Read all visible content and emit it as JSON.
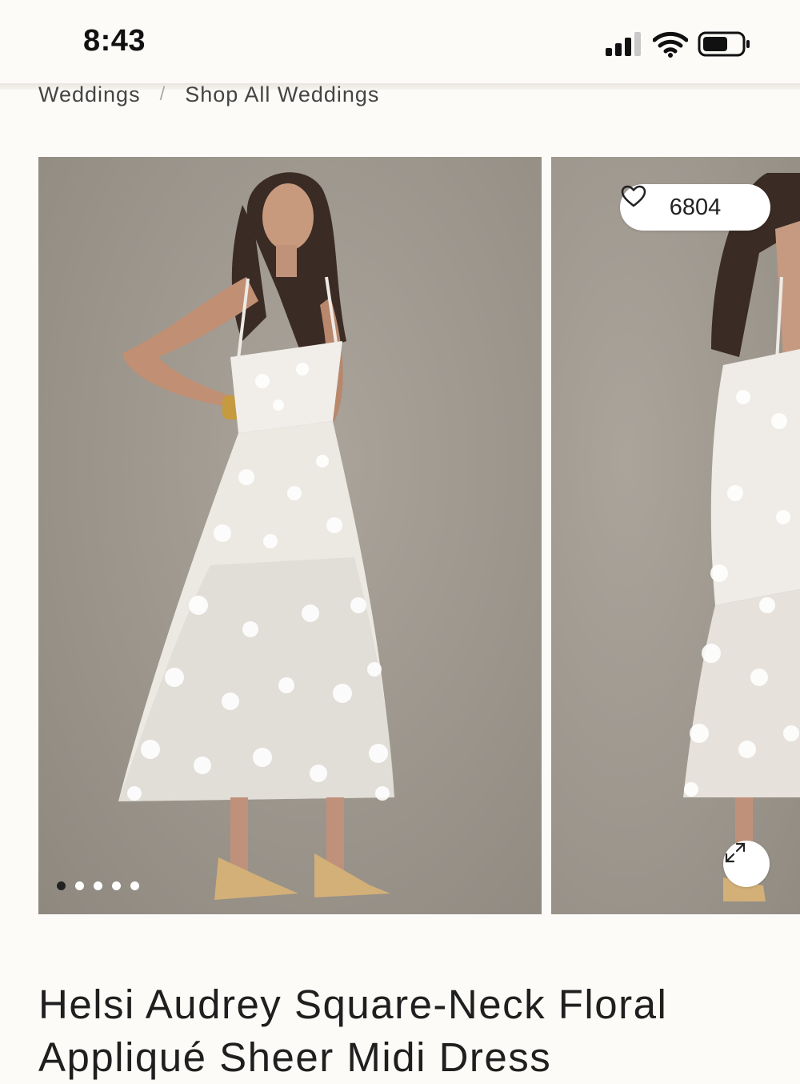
{
  "status_bar": {
    "time": "8:43"
  },
  "breadcrumb": {
    "items": [
      "Weddings",
      "Shop All Weddings"
    ],
    "separator": "/"
  },
  "gallery": {
    "favorites_count": "6804",
    "image_count": 5,
    "active_index": 0,
    "icons": {
      "favorite": "heart-icon",
      "expand": "expand-icon"
    }
  },
  "product": {
    "title": "Helsi Audrey Square-Neck Floral Appliqué Sheer Midi Dress"
  },
  "colors": {
    "background": "#fcfbf8",
    "photo_backdrop": "#9e988f",
    "text": "#1f1f1f"
  }
}
